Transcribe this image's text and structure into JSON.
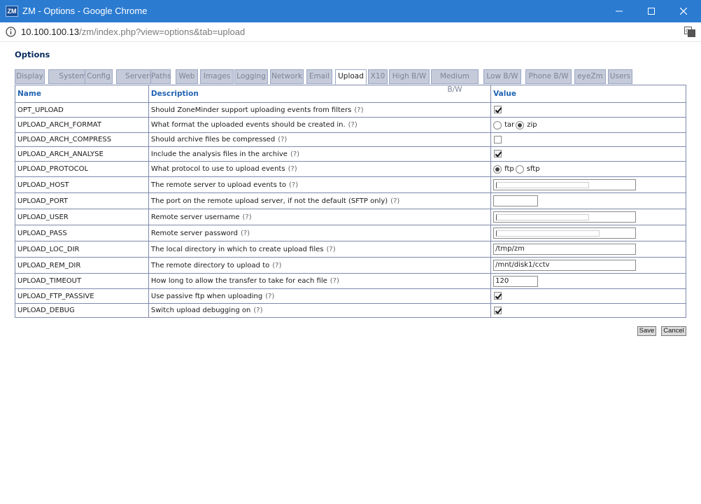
{
  "window": {
    "icon_text": "ZM",
    "title": "ZM - Options - Google Chrome"
  },
  "address": {
    "host": "10.100.100.13",
    "path": "/zm/index.php?view=options&tab=upload"
  },
  "page": {
    "heading": "Options"
  },
  "tabs": [
    {
      "label": "Display",
      "active": false
    },
    {
      "label": "System",
      "active": false
    },
    {
      "label": "Config",
      "active": false
    },
    {
      "label": "Servers",
      "active": false
    },
    {
      "label": "Paths",
      "active": false
    },
    {
      "label": "Web",
      "active": false
    },
    {
      "label": "Images",
      "active": false
    },
    {
      "label": "Logging",
      "active": false
    },
    {
      "label": "Network",
      "active": false
    },
    {
      "label": "Email",
      "active": false
    },
    {
      "label": "Upload",
      "active": true
    },
    {
      "label": "X10",
      "active": false
    },
    {
      "label": "High B/W",
      "active": false
    },
    {
      "label": "Medium B/W",
      "active": false
    },
    {
      "label": "Low B/W",
      "active": false
    },
    {
      "label": "Phone B/W",
      "active": false
    },
    {
      "label": "eyeZm",
      "active": false
    },
    {
      "label": "Users",
      "active": false
    }
  ],
  "table": {
    "headers": {
      "name": "Name",
      "description": "Description",
      "value": "Value"
    },
    "help_marker": "(?)",
    "rows": [
      {
        "name": "OPT_UPLOAD",
        "description": "Should ZoneMinder support uploading events from filters",
        "control": "checkbox",
        "checked": true
      },
      {
        "name": "UPLOAD_ARCH_FORMAT",
        "description": "What format the uploaded events should be created in.",
        "control": "radio",
        "options": [
          "tar",
          "zip"
        ],
        "selected": "zip"
      },
      {
        "name": "UPLOAD_ARCH_COMPRESS",
        "description": "Should archive files be compressed",
        "control": "checkbox",
        "checked": false
      },
      {
        "name": "UPLOAD_ARCH_ANALYSE",
        "description": "Include the analysis files in the archive",
        "control": "checkbox",
        "checked": true
      },
      {
        "name": "UPLOAD_PROTOCOL",
        "description": "What protocol to use to upload events",
        "control": "radio",
        "options": [
          "ftp",
          "sftp"
        ],
        "selected": "ftp"
      },
      {
        "name": "UPLOAD_HOST",
        "description": "The remote server to upload events to",
        "control": "text-masked",
        "value": ""
      },
      {
        "name": "UPLOAD_PORT",
        "description": "The port on the remote upload server, if not the default (SFTP only)",
        "control": "text-short",
        "value": ""
      },
      {
        "name": "UPLOAD_USER",
        "description": "Remote server username",
        "control": "text-masked",
        "value": ""
      },
      {
        "name": "UPLOAD_PASS",
        "description": "Remote server password",
        "control": "text-masked",
        "value": ""
      },
      {
        "name": "UPLOAD_LOC_DIR",
        "description": "The local directory in which to create upload files",
        "control": "text",
        "value": "/tmp/zm"
      },
      {
        "name": "UPLOAD_REM_DIR",
        "description": "The remote directory to upload to",
        "control": "text",
        "value": "/mnt/disk1/cctv"
      },
      {
        "name": "UPLOAD_TIMEOUT",
        "description": "How long to allow the transfer to take for each file",
        "control": "text-short",
        "value": "120"
      },
      {
        "name": "UPLOAD_FTP_PASSIVE",
        "description": "Use passive ftp when uploading",
        "control": "checkbox",
        "checked": true
      },
      {
        "name": "UPLOAD_DEBUG",
        "description": "Switch upload debugging on",
        "control": "checkbox",
        "checked": true
      }
    ]
  },
  "buttons": {
    "save": "Save",
    "cancel": "Cancel"
  }
}
